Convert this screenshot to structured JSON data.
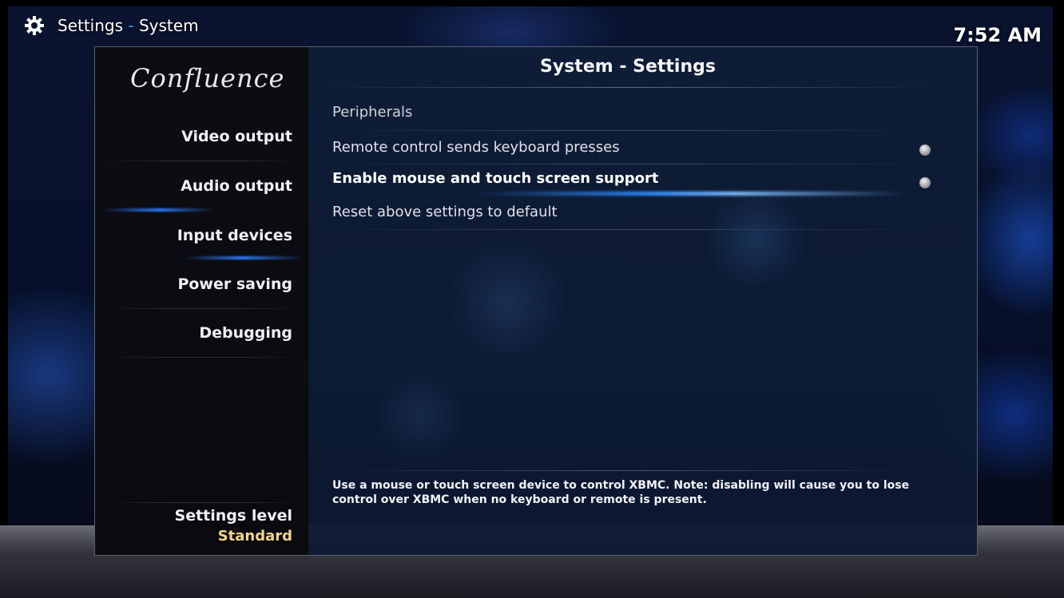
{
  "header": {
    "title": "Settings",
    "separator": "-",
    "section": "System",
    "clock": "7:52 AM"
  },
  "sidebar": {
    "logo": "Confluence",
    "items": [
      {
        "label": "Video output"
      },
      {
        "label": "Audio output"
      },
      {
        "label": "Input devices"
      },
      {
        "label": "Power saving"
      },
      {
        "label": "Debugging"
      }
    ],
    "selected": "Input devices",
    "settings_level_label": "Settings level",
    "settings_level_value": "Standard"
  },
  "content": {
    "title": "System - Settings",
    "category": "Peripherals",
    "options": [
      {
        "label": "Remote control sends keyboard presses"
      },
      {
        "label": "Enable mouse and touch screen support"
      },
      {
        "label": "Reset above settings to default"
      }
    ],
    "help_text": "Use a mouse or touch screen device to control XBMC. Note: disabling will cause you to lose control over XBMC when no keyboard or remote is present."
  },
  "colors": {
    "accent": "#2d7dff",
    "separator": "#4aa3ff",
    "settings_level_value": "#f2d48a"
  },
  "icons": {
    "header": "gear-icon"
  }
}
